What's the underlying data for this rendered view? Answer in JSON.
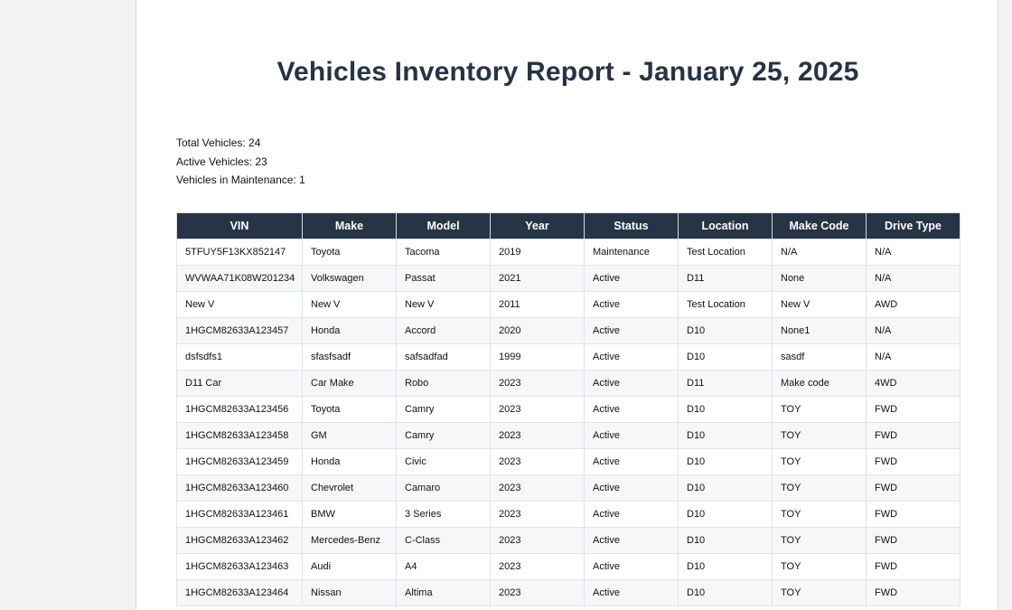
{
  "report": {
    "title": "Vehicles Inventory Report - January 25, 2025",
    "summary": {
      "total": "Total Vehicles: 24",
      "active": "Active Vehicles: 23",
      "maintenance": "Vehicles in Maintenance: 1"
    }
  },
  "table": {
    "columns": [
      "VIN",
      "Make",
      "Model",
      "Year",
      "Status",
      "Location",
      "Make Code",
      "Drive Type"
    ],
    "rows": [
      [
        "5TFUY5F13KX852147",
        "Toyota",
        "Tacoma",
        "2019",
        "Maintenance",
        "Test Location",
        "N/A",
        "N/A"
      ],
      [
        "WVWAA71K08W201234",
        "Volkswagen",
        "Passat",
        "2021",
        "Active",
        "D11",
        "None",
        "N/A"
      ],
      [
        "New V",
        "New V",
        "New V",
        "2011",
        "Active",
        "Test Location",
        "New V",
        "AWD"
      ],
      [
        "1HGCM82633A123457",
        "Honda",
        "Accord",
        "2020",
        "Active",
        "D10",
        "None1",
        "N/A"
      ],
      [
        "dsfsdfs1",
        "sfasfsadf",
        "safsadfad",
        "1999",
        "Active",
        "D10",
        "sasdf",
        "N/A"
      ],
      [
        "D11 Car",
        "Car Make",
        "Robo",
        "2023",
        "Active",
        "D11",
        "Make code",
        "4WD"
      ],
      [
        "1HGCM82633A123456",
        "Toyota",
        "Camry",
        "2023",
        "Active",
        "D10",
        "TOY",
        "FWD"
      ],
      [
        "1HGCM82633A123458",
        "GM",
        "Camry",
        "2023",
        "Active",
        "D10",
        "TOY",
        "FWD"
      ],
      [
        "1HGCM82633A123459",
        "Honda",
        "Civic",
        "2023",
        "Active",
        "D10",
        "TOY",
        "FWD"
      ],
      [
        "1HGCM82633A123460",
        "Chevrolet",
        "Camaro",
        "2023",
        "Active",
        "D10",
        "TOY",
        "FWD"
      ],
      [
        "1HGCM82633A123461",
        "BMW",
        "3 Series",
        "2023",
        "Active",
        "D10",
        "TOY",
        "FWD"
      ],
      [
        "1HGCM82633A123462",
        "Mercedes-Benz",
        "C-Class",
        "2023",
        "Active",
        "D10",
        "TOY",
        "FWD"
      ],
      [
        "1HGCM82633A123463",
        "Audi",
        "A4",
        "2023",
        "Active",
        "D10",
        "TOY",
        "FWD"
      ],
      [
        "1HGCM82633A123464",
        "Nissan",
        "Altima",
        "2023",
        "Active",
        "D10",
        "TOY",
        "FWD"
      ]
    ]
  },
  "colors": {
    "header_bg": "#263445",
    "title_text": "#263445",
    "zebra_row": "#f6f7f9"
  }
}
